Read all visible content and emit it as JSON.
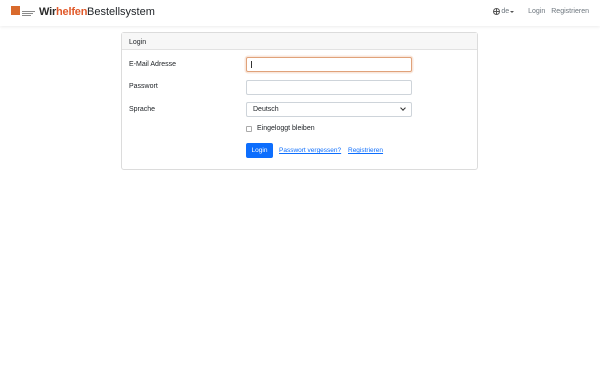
{
  "brand": {
    "logo_text_prefix": "Wir",
    "logo_text_accent": "helfen",
    "title": "Bestellsystem"
  },
  "nav": {
    "language": "de",
    "login": "Login",
    "register": "Registrieren"
  },
  "login_form": {
    "header": "Login",
    "email_label": "E-Mail Adresse",
    "email_value": "",
    "password_label": "Passwort",
    "password_value": "",
    "language_label": "Sprache",
    "language_selected": "Deutsch",
    "remember_label": "Eingeloggt bleiben",
    "remember_checked": false,
    "submit_label": "Login",
    "forgot_link": "Passwort vergessen?",
    "register_link": "Registrieren"
  },
  "colors": {
    "primary": "#0d6efd",
    "brand_accent": "#e0592a",
    "focus_border": "#e0a27a"
  }
}
